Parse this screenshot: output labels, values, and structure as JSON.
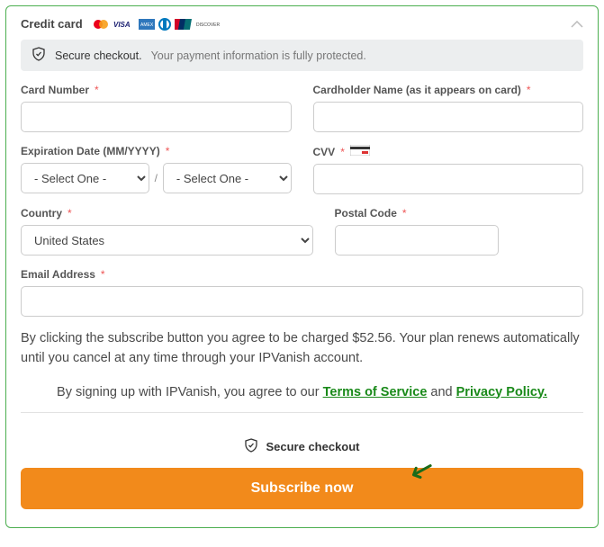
{
  "header": {
    "title": "Credit card"
  },
  "secure_banner": {
    "prefix": "Secure checkout.",
    "detail": "Your payment information is fully protected."
  },
  "fields": {
    "card_number": {
      "label": "Card Number"
    },
    "cardholder": {
      "label": "Cardholder Name (as it appears on card)"
    },
    "expiration": {
      "label": "Expiration Date (MM/YYYY)",
      "month_selected": "- Select One -",
      "year_selected": "- Select One -",
      "separator": "/"
    },
    "cvv": {
      "label": "CVV"
    },
    "country": {
      "label": "Country",
      "selected": "United States"
    },
    "postal": {
      "label": "Postal Code"
    },
    "email": {
      "label": "Email Address"
    }
  },
  "disclaimer": "By clicking the subscribe button you agree to be charged $52.56. Your plan renews automatically until you cancel at any time through your IPVanish account.",
  "agreement": {
    "prefix": "By signing up with IPVanish, you agree to our ",
    "tos": "Terms of Service",
    "and": " and ",
    "pp": "Privacy Policy."
  },
  "secure_checkout2": "Secure checkout",
  "subscribe_btn": "Subscribe now",
  "required_mark": "*"
}
